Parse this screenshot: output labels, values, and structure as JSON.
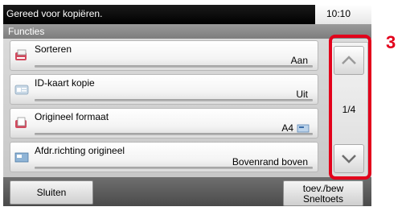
{
  "status": {
    "message": "Gereed voor kopiëren.",
    "time": "10:10"
  },
  "title": "Functies",
  "items": [
    {
      "label": "Sorteren",
      "value": "Aan",
      "icon": "sort-icon"
    },
    {
      "label": "ID-kaart kopie",
      "value": "Uit",
      "icon": "id-card-icon"
    },
    {
      "label": "Origineel formaat",
      "value": "A4",
      "icon": "original-size-icon",
      "value_icon": "paper-orientation-icon"
    },
    {
      "label": "Afdr.richting origineel",
      "value": "Bovenrand boven",
      "icon": "orientation-icon"
    }
  ],
  "scroll": {
    "page": "1/4",
    "up_icon": "chevron-up-icon",
    "down_icon": "chevron-down-icon"
  },
  "callout": "3",
  "footer": {
    "close_label": "Sluiten",
    "shortcut_line1": "toev./bew",
    "shortcut_line2": "Sneltoets"
  },
  "colors": {
    "highlight": "#e3001b",
    "statusbar": "#000000",
    "titlebar": "#8a8a8a"
  }
}
